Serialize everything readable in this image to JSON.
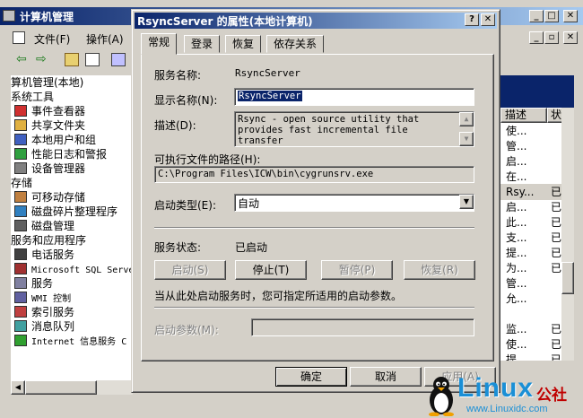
{
  "mmc": {
    "title": "计算机管理",
    "menu": {
      "file": "文件(F)",
      "action": "操作(A)"
    },
    "tree": [
      {
        "label": "算机管理(本地)",
        "indent": 0,
        "icon": "none"
      },
      {
        "label": "系统工具",
        "indent": 0,
        "icon": "none"
      },
      {
        "label": "事件查看器",
        "indent": 1,
        "icon": "event-viewer-icon"
      },
      {
        "label": "共享文件夹",
        "indent": 1,
        "icon": "shared-folder-icon"
      },
      {
        "label": "本地用户和组",
        "indent": 1,
        "icon": "users-icon"
      },
      {
        "label": "性能日志和警报",
        "indent": 1,
        "icon": "performance-icon"
      },
      {
        "label": "设备管理器",
        "indent": 1,
        "icon": "device-manager-icon"
      },
      {
        "label": "存储",
        "indent": 0,
        "icon": "none"
      },
      {
        "label": "可移动存储",
        "indent": 1,
        "icon": "removable-storage-icon"
      },
      {
        "label": "磁盘碎片整理程序",
        "indent": 1,
        "icon": "defrag-icon"
      },
      {
        "label": "磁盘管理",
        "indent": 1,
        "icon": "disk-management-icon"
      },
      {
        "label": "服务和应用程序",
        "indent": 0,
        "icon": "none"
      },
      {
        "label": "电话服务",
        "indent": 1,
        "icon": "telephony-icon"
      },
      {
        "label": "Microsoft SQL Serve",
        "indent": 1,
        "icon": "sql-server-icon"
      },
      {
        "label": "服务",
        "indent": 1,
        "icon": "services-icon"
      },
      {
        "label": "WMI 控制",
        "indent": 1,
        "icon": "wmi-icon"
      },
      {
        "label": "索引服务",
        "indent": 1,
        "icon": "indexing-icon"
      },
      {
        "label": "消息队列",
        "indent": 1,
        "icon": "message-queue-icon"
      },
      {
        "label": "Internet 信息服务 C",
        "indent": 1,
        "icon": "iis-icon"
      }
    ],
    "list": {
      "col_desc": "描述",
      "col_status": "状",
      "rows": [
        {
          "desc": "使...",
          "status": ""
        },
        {
          "desc": "管...",
          "status": ""
        },
        {
          "desc": "启...",
          "status": ""
        },
        {
          "desc": "在...",
          "status": ""
        },
        {
          "desc": "Rsy...",
          "status": "已"
        },
        {
          "desc": "启...",
          "status": "已"
        },
        {
          "desc": "此...",
          "status": "已"
        },
        {
          "desc": "支...",
          "status": "已"
        },
        {
          "desc": "提...",
          "status": "已"
        },
        {
          "desc": "为...",
          "status": "已"
        },
        {
          "desc": "管...",
          "status": ""
        },
        {
          "desc": "允...",
          "status": ""
        },
        {
          "desc": "",
          "status": ""
        },
        {
          "desc": "监...",
          "status": "已"
        },
        {
          "desc": "使...",
          "status": "已"
        },
        {
          "desc": "提...",
          "status": "已"
        }
      ]
    }
  },
  "dialog": {
    "title": "RsyncServer 的属性(本地计算机)",
    "tabs": [
      "常规",
      "登录",
      "恢复",
      "依存关系"
    ],
    "service_name_label": "服务名称:",
    "service_name": "RsyncServer",
    "display_name_label": "显示名称(N):",
    "display_name": "RsyncServer",
    "description_label": "描述(D):",
    "description": "Rsync - open source utility that provides fast incremental file transfer",
    "exe_path_label": "可执行文件的路径(H):",
    "exe_path": "C:\\Program Files\\ICW\\bin\\cygrunsrv.exe",
    "startup_type_label": "启动类型(E):",
    "startup_type": "自动",
    "service_status_label": "服务状态:",
    "service_status": "已启动",
    "start_button": "启动(S)",
    "stop_button": "停止(T)",
    "pause_button": "暂停(P)",
    "resume_button": "恢复(R)",
    "hint": "当从此处启动服务时，您可指定所适用的启动参数。",
    "start_params_label": "启动参数(M):",
    "start_params": "",
    "ok_button": "确定",
    "cancel_button": "取消",
    "apply_button": "应用(A)"
  },
  "watermark": {
    "brand": "Linux",
    "suffix": "公社",
    "url": "www.Linuxidc.com"
  }
}
